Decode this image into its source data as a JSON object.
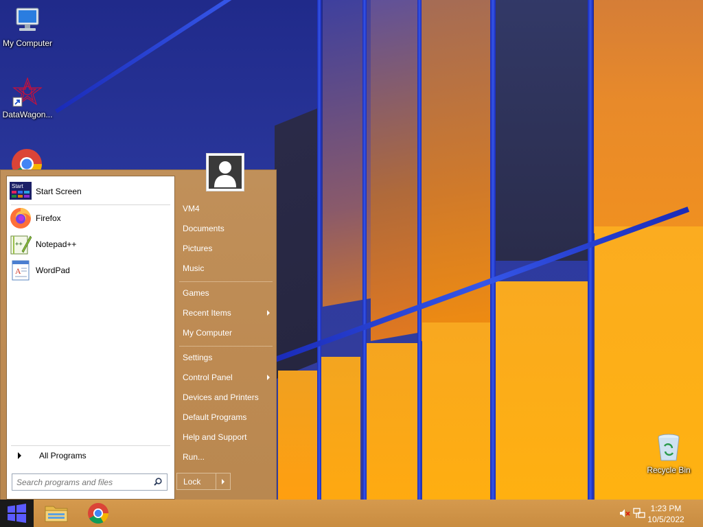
{
  "desktop": {
    "icons": [
      {
        "label": "My Computer",
        "icon": "my-computer-icon"
      },
      {
        "label": "DataWagon...",
        "icon": "datawagon-shortcut-icon"
      },
      {
        "label": "Recycle Bin",
        "icon": "recycle-bin-icon"
      }
    ]
  },
  "start_menu": {
    "pinned": [
      {
        "label": "Start Screen",
        "icon": "start-screen-icon",
        "icon_text": "Start"
      },
      {
        "label": "Firefox",
        "icon": "firefox-icon"
      },
      {
        "label": "Notepad++",
        "icon": "notepad-plus-plus-icon"
      },
      {
        "label": "WordPad",
        "icon": "wordpad-icon"
      }
    ],
    "all_programs": "All Programs",
    "search_placeholder": "Search programs and files",
    "right_items": [
      {
        "label": "VM4"
      },
      {
        "label": "Documents"
      },
      {
        "label": "Pictures"
      },
      {
        "label": "Music"
      },
      {
        "label": "Games"
      },
      {
        "label": "Recent Items",
        "submenu": true
      },
      {
        "label": "My Computer"
      },
      {
        "label": "Settings"
      },
      {
        "label": "Control Panel",
        "submenu": true
      },
      {
        "label": "Devices and Printers"
      },
      {
        "label": "Default Programs"
      },
      {
        "label": "Help and Support"
      },
      {
        "label": "Run..."
      }
    ],
    "lock_label": "Lock"
  },
  "taskbar": {
    "apps": [
      {
        "icon": "file-explorer-icon"
      },
      {
        "icon": "chrome-icon"
      }
    ],
    "tray": {
      "volume_icon": "volume-muted-icon",
      "network_icon": "network-icon"
    },
    "clock": {
      "time": "1:23 PM",
      "date": "10/5/2022"
    }
  },
  "colors": {
    "start_menu_bg": "#bd8a52",
    "taskbar_bg": "#d09446",
    "start_button_bg": "#1a1a1a",
    "windows_logo": "#5b5bff"
  }
}
